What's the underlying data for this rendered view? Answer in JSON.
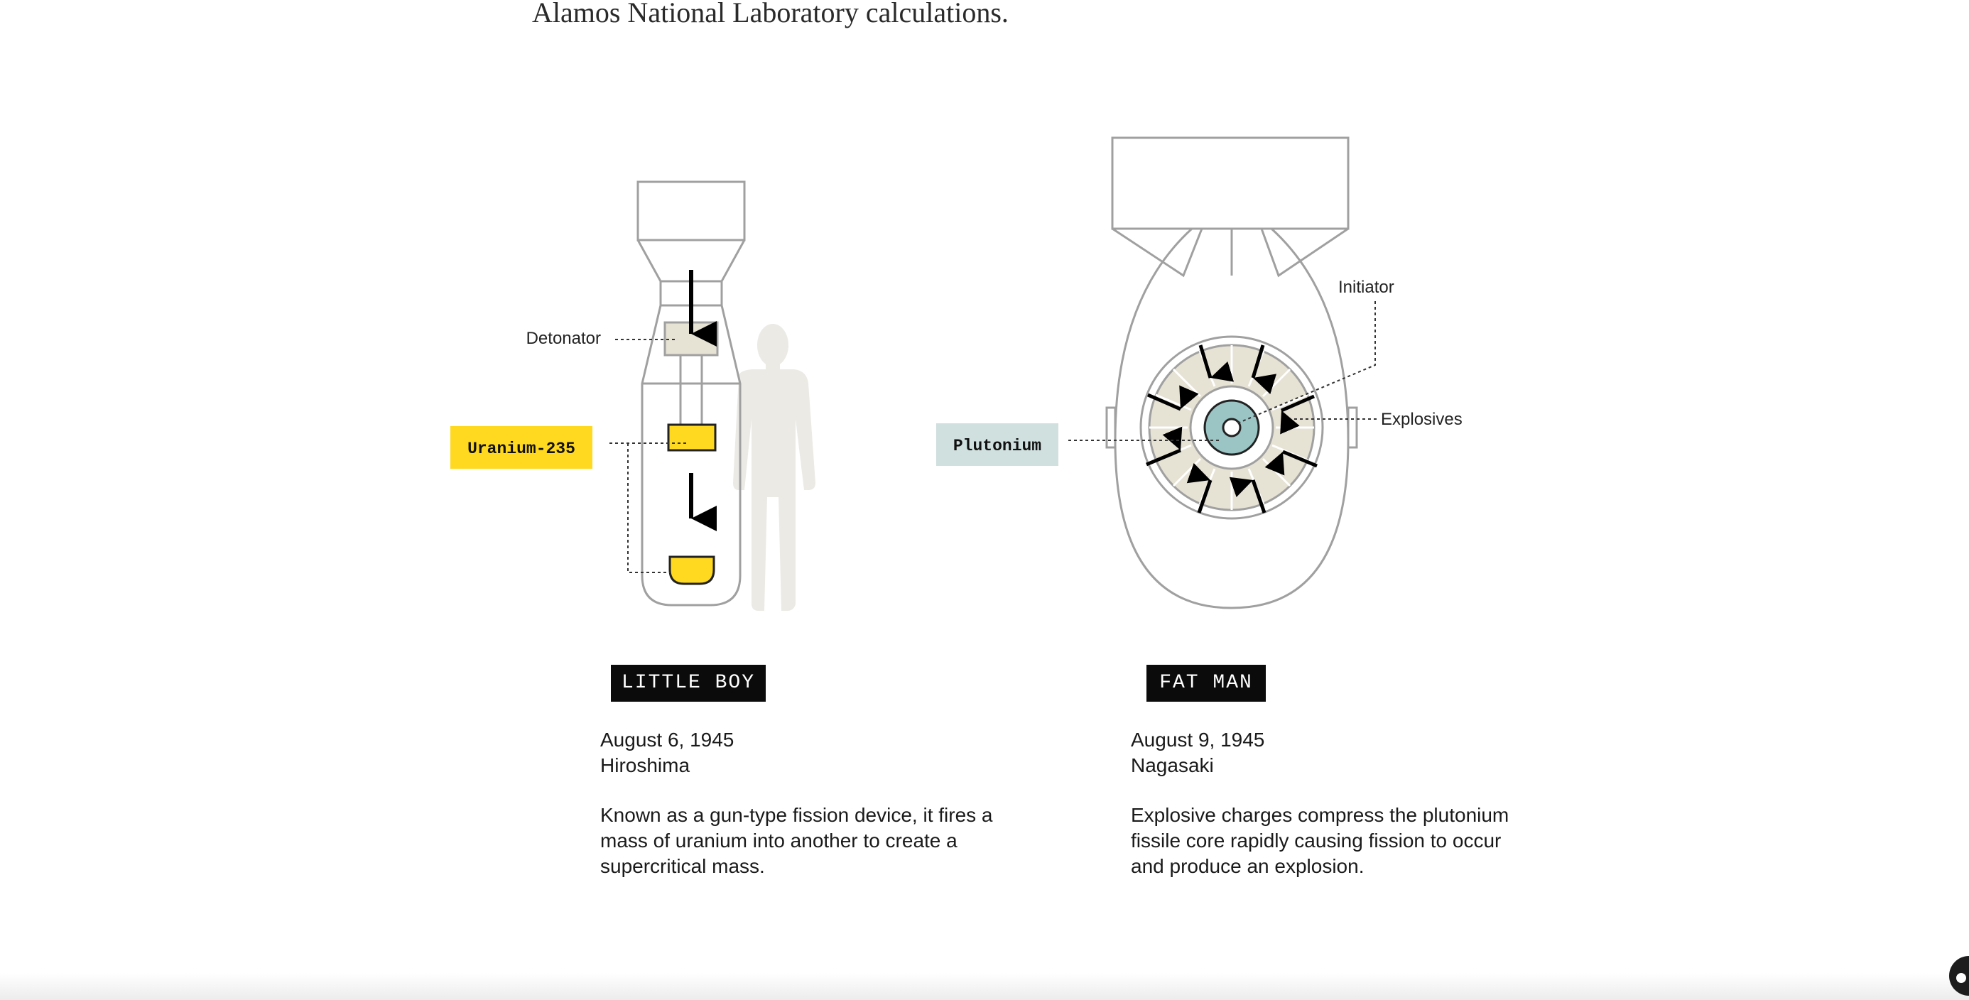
{
  "intro": {
    "text": "Alamos National Laboratory calculations."
  },
  "little_boy": {
    "name": "LITTLE BOY",
    "date": "August 6, 1945",
    "city": "Hiroshima",
    "description": "Known as a gun-type fission device, it fires a mass of uranium into another to create a supercritical mass.",
    "labels": {
      "detonator": "Detonator",
      "uranium": "Uranium-235"
    }
  },
  "fat_man": {
    "name": "FAT MAN",
    "date": "August 9, 1945",
    "city": "Nagasaki",
    "description": "Explosive charges compress the plutonium fissile core rapidly causing fission to occur and produce an explosion.",
    "labels": {
      "initiator": "Initiator",
      "explosives": "Explosives",
      "plutonium": "Plutonium"
    }
  },
  "colors": {
    "uranium": "#ffd820",
    "plutonium": "#cfe0de",
    "core": "#9bc4c4",
    "explosive_fill": "#e6e2d4",
    "outline": "#a0a0a0",
    "silhouette": "#eceae5",
    "badge_background": "#0b0b0b"
  }
}
